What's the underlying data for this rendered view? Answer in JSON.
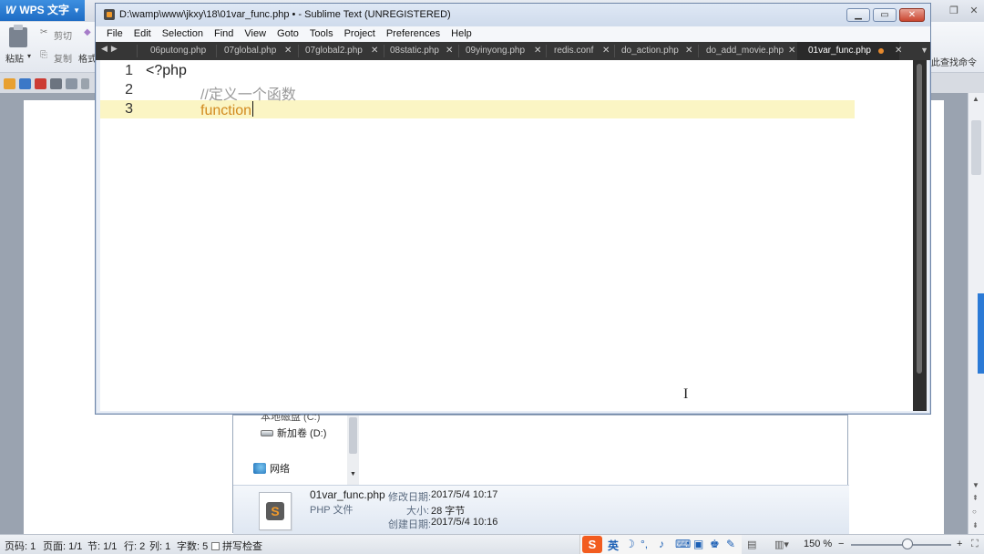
{
  "wps": {
    "app_name": "WPS 文字",
    "ribbon": {
      "paste": "粘贴",
      "cut": "剪切",
      "copy": "复制",
      "format": "格式",
      "find_cmd": "此查找命令"
    },
    "status": {
      "page_num": "页码: 1",
      "page": "页面: 1/1",
      "section": "节: 1/1",
      "line": "行: 2",
      "col": "列: 1",
      "chars": "字数: 5",
      "spell": "拼写检查",
      "zoom": "150 %"
    },
    "ime": {
      "lang": "英"
    }
  },
  "explorer": {
    "drive_c": "本地磁盘 (C:)",
    "drive_d": "新加卷 (D:)",
    "network": "网络",
    "file_name": "01var_func.php",
    "file_type": "PHP 文件",
    "modified_label": "修改日期:",
    "modified_value": "2017/5/4 10:17",
    "size_label": "大小:",
    "size_value": "28 字节",
    "created_label": "创建日期:",
    "created_value": "2017/5/4 10:16"
  },
  "sublime": {
    "title": "D:\\wamp\\www\\jkxy\\18\\01var_func.php • - Sublime Text (UNREGISTERED)",
    "menu": [
      "File",
      "Edit",
      "Selection",
      "Find",
      "View",
      "Goto",
      "Tools",
      "Project",
      "Preferences",
      "Help"
    ],
    "tabs": [
      "06putong.php",
      "07global.php",
      "07global2.php",
      "08static.php",
      "09yinyong.php",
      "redis.conf",
      "do_action.php",
      "do_add_movie.php",
      "01var_func.php"
    ],
    "active_tab": "01var_func.php",
    "lines": [
      {
        "num": "1",
        "text": "<?php"
      },
      {
        "num": "2",
        "text": "//定义一个函数"
      },
      {
        "num": "3",
        "text": "function"
      }
    ]
  },
  "colors": {
    "keyword": "#d28a1f",
    "comment": "#9a9a9a",
    "line_highlight": "#fbf5c4",
    "tabbar": "#363636",
    "dirty_dot": "#e68a2e"
  }
}
